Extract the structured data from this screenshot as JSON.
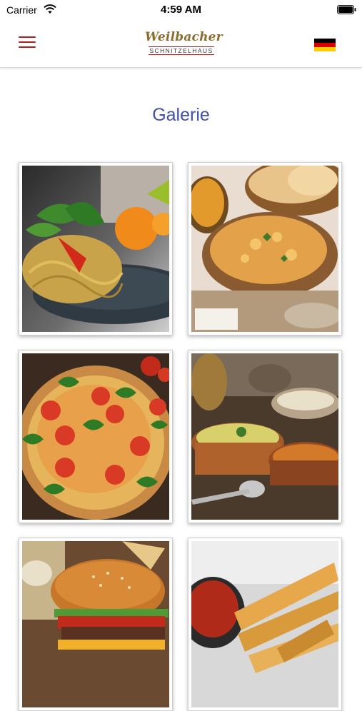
{
  "status_bar": {
    "carrier": "Carrier",
    "time": "4:59 AM"
  },
  "header": {
    "logo_script": "Weilbacher",
    "logo_sub": "SCHNITZELHAUS",
    "menu_icon": "hamburger-menu-icon",
    "language_flag": "german-flag-icon",
    "accent_color": "#b71c1c"
  },
  "page": {
    "title": "Galerie",
    "title_color": "#3f51a8"
  },
  "gallery": {
    "images": [
      {
        "subject": "spaghetti-with-basil"
      },
      {
        "subject": "curry-with-naan"
      },
      {
        "subject": "margherita-pizza"
      },
      {
        "subject": "indian-dishes-in-copper-bowls"
      },
      {
        "subject": "burger"
      },
      {
        "subject": "spring-rolls-with-dip"
      }
    ]
  }
}
